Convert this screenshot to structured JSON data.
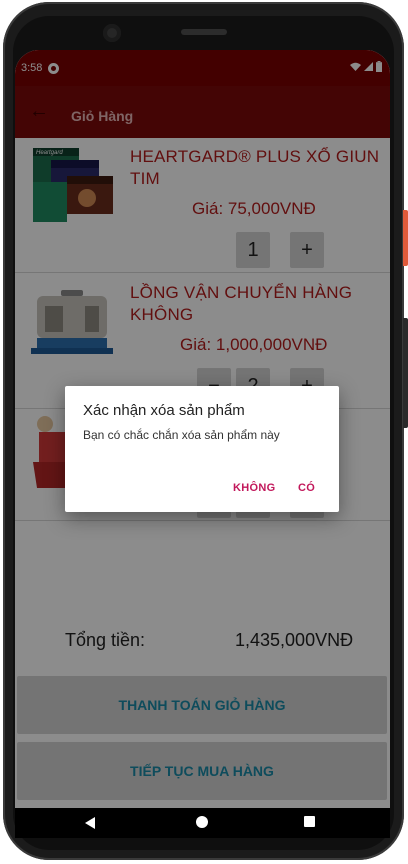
{
  "status": {
    "time": "3:58"
  },
  "appbar": {
    "title": "Giỏ Hàng"
  },
  "cart": {
    "items": [
      {
        "name": "HEARTGARD® PLUS XỔ GIUN TIM",
        "price": "Giá: 75,000VNĐ",
        "quantity": "1",
        "image_label": "Heartgard"
      },
      {
        "name": "LỒNG VẬN CHUYỂN HÀNG KHÔNG",
        "price": "Giá: 1,000,000VNĐ",
        "quantity": "2"
      },
      {
        "name": "",
        "price": "",
        "quantity": ""
      }
    ],
    "plus_label": "+",
    "minus_label": "−"
  },
  "total": {
    "label": "Tổng tiền:",
    "value": "1,435,000VNĐ"
  },
  "buttons": {
    "checkout": "THANH TOÁN GIỎ HÀNG",
    "continue": "TIẾP TỤC MUA HÀNG"
  },
  "dialog": {
    "title": "Xác nhận xóa sản phẩm",
    "message": "Bạn có chắc chắn xóa sản phẩm này",
    "negative": "KHÔNG",
    "positive": "CÓ"
  },
  "colors": {
    "appbar": "#7d0a0a",
    "status": "#7a0000",
    "accent": "#b31d1d",
    "button_text": "#1a8ba8",
    "dialog_button": "#c2185b"
  }
}
